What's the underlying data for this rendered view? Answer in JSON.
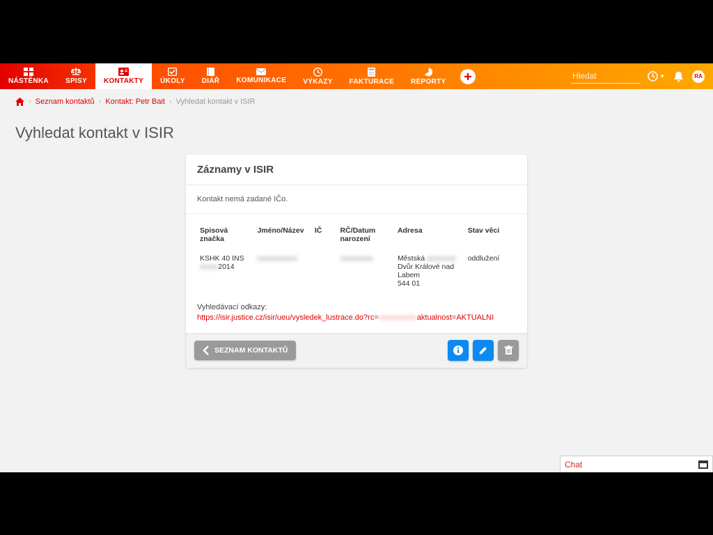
{
  "nav": {
    "items": [
      {
        "label": "NÁSTĚNKA",
        "icon": "dashboard"
      },
      {
        "label": "SPISY",
        "icon": "scales"
      },
      {
        "label": "KONTAKTY",
        "icon": "contact",
        "active": true
      },
      {
        "label": "ÚKOLY",
        "icon": "check"
      },
      {
        "label": "DIÁŘ",
        "icon": "book"
      },
      {
        "label": "KOMUNIKACE",
        "icon": "mail"
      },
      {
        "label": "VÝKAZY",
        "icon": "clock"
      },
      {
        "label": "FAKTURACE",
        "icon": "calc"
      },
      {
        "label": "REPORTY",
        "icon": "pie"
      }
    ]
  },
  "search": {
    "placeholder": "Hledat"
  },
  "avatar": {
    "initials": "RA"
  },
  "breadcrumb": {
    "links": [
      {
        "label": "Seznam kontaktů"
      },
      {
        "label": "Kontakt: Petr Bait"
      }
    ],
    "current": "Vyhledat kontakt v ISIR"
  },
  "page": {
    "title": "Vyhledat kontakt v ISIR"
  },
  "card": {
    "header": "Záznamy v ISIR",
    "note": "Kontakt nemá zadané IČo.",
    "columns": [
      "Spisová značka",
      "Jméno/Název",
      "IČ",
      "RČ/Datum narození",
      "Adresa",
      "Stav věci"
    ],
    "row": {
      "spis1": "KSHK 40 INS",
      "spis2_blur": "xxxxx",
      "spis2_year": "2014",
      "jmeno_blur": "xxxxxxxxxxx",
      "ic": "",
      "rc_blur": "xxxxxxxxx",
      "adresa_l1a": "Městská",
      "adresa_l1b_blur": "xxxxxxxx",
      "adresa_l2": "Dvůr Králové nad Labem",
      "adresa_l3": "544 01",
      "stav": "oddlužení"
    },
    "links_label": "Vyhledávací odkazy:",
    "link_pre": "https://isir.justice.cz/isir/ueu/vysledek_lustrace.do?rc=",
    "link_blur": "xxxxxxxxxx",
    "link_post": "aktualnost=AKTUALNI"
  },
  "footer": {
    "back": "SEZNAM KONTAKTŮ"
  },
  "chat": {
    "label": "Chat"
  }
}
